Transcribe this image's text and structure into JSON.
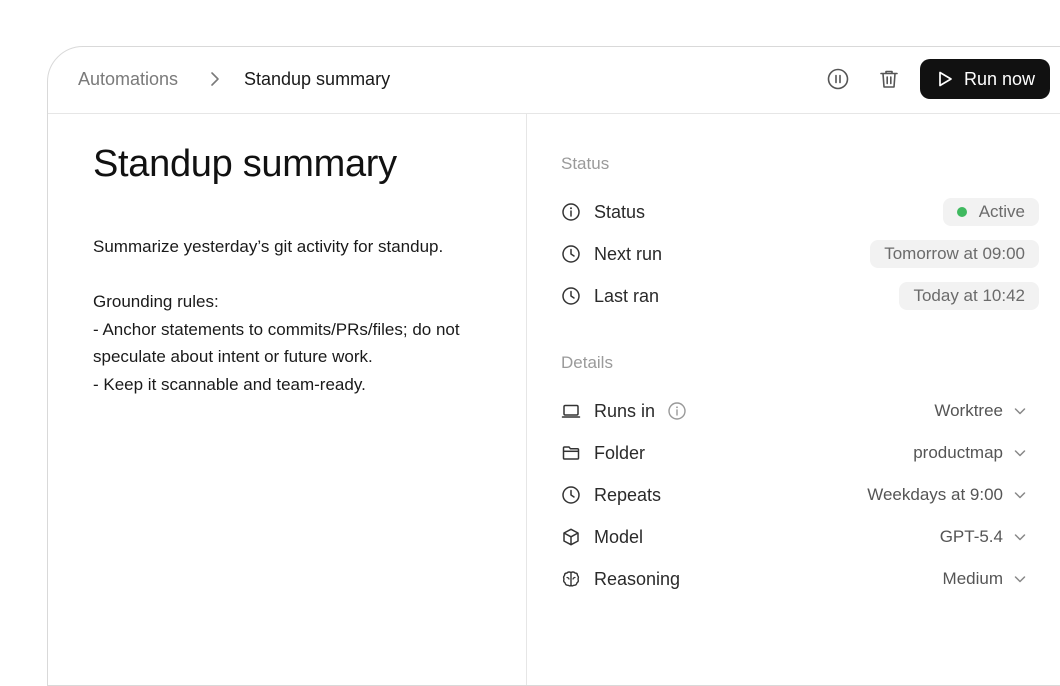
{
  "breadcrumb": {
    "root": "Automations",
    "current": "Standup summary"
  },
  "toolbar": {
    "pause_icon": "pause-circle-icon",
    "delete_icon": "trash-icon",
    "run_label": "Run now",
    "run_color": "#111111"
  },
  "automation": {
    "title": "Standup summary",
    "description": [
      "Summarize yesterday’s git activity for standup.",
      "",
      "Grounding rules:",
      "- Anchor statements to commits/PRs/files; do not speculate about intent or future work.",
      "- Keep it scannable and team-ready."
    ]
  },
  "status_section": {
    "label": "Status",
    "rows": [
      {
        "icon": "info-icon",
        "label": "Status",
        "value": "Active",
        "status_color": "#3fb95f"
      },
      {
        "icon": "clock-icon",
        "label": "Next run",
        "value": "Tomorrow at 09:00"
      },
      {
        "icon": "clock-icon",
        "label": "Last ran",
        "value": "Today at 10:42"
      }
    ]
  },
  "details_section": {
    "label": "Details",
    "rows": [
      {
        "icon": "laptop-icon",
        "label": "Runs in",
        "value": "Worktree"
      },
      {
        "icon": "folder-icon",
        "label": "Folder",
        "value": "productmap"
      },
      {
        "icon": "clock-icon",
        "label": "Repeats",
        "value": "Weekdays at 9:00"
      },
      {
        "icon": "cube-icon",
        "label": "Model",
        "value": "GPT-5.4"
      },
      {
        "icon": "brain-icon",
        "label": "Reasoning",
        "value": "Medium"
      }
    ]
  }
}
